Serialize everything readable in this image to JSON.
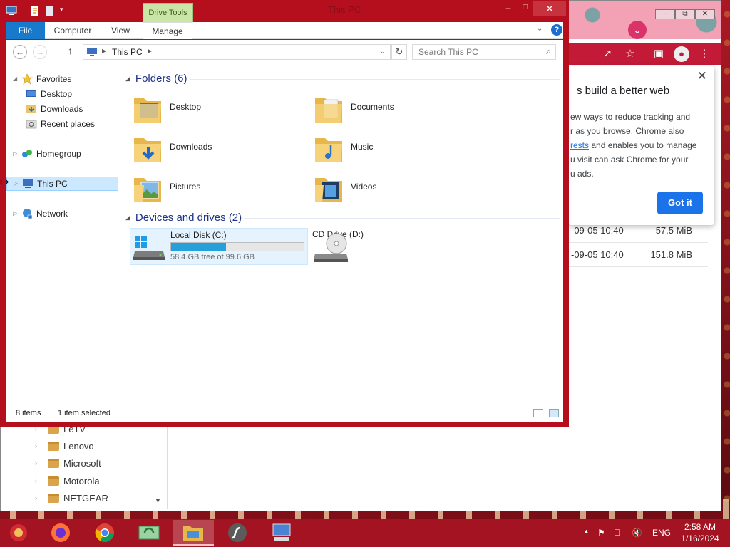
{
  "explorer": {
    "title": "This PC",
    "context_tab": "Drive Tools",
    "tabs": [
      "File",
      "Computer",
      "View",
      "Manage"
    ],
    "address": {
      "segment": "This PC"
    },
    "search_placeholder": "Search This PC",
    "nav": {
      "favorites": "Favorites",
      "desktop": "Desktop",
      "downloads": "Downloads",
      "recent": "Recent places",
      "homegroup": "Homegroup",
      "thispc": "This PC",
      "network": "Network"
    },
    "folders_header": "Folders (6)",
    "folders": [
      "Desktop",
      "Documents",
      "Downloads",
      "Music",
      "Pictures",
      "Videos"
    ],
    "devices_header": "Devices and drives (2)",
    "drives": {
      "local_name": "Local Disk (C:)",
      "local_free": "58.4 GB free of 99.6 GB",
      "local_used_fraction": 0.414,
      "cd_name": "CD Drive (D:)"
    },
    "status": {
      "items": "8 items",
      "selected": "1 item selected"
    }
  },
  "chrome": {
    "popup": {
      "title": "s build a better web",
      "line1": "ew ways to reduce tracking and",
      "line2": "r as you browse. Chrome also",
      "line3_link": "rests",
      "line3_rest": " and enables you to manage",
      "line4": "u visit can ask Chrome for your",
      "line5": "u ads.",
      "button": "Got it"
    },
    "downloads": [
      {
        "date": "-09-05 10:40",
        "size": "57.5 MiB"
      },
      {
        "date": "-09-05 10:40",
        "size": "151.8 MiB"
      }
    ],
    "folders": [
      "LeTV",
      "Lenovo",
      "Microsoft",
      "Motorola",
      "NETGEAR"
    ]
  },
  "taskbar": {
    "apps": [
      "firefox-icon",
      "chrome-icon",
      "sync-icon",
      "file-explorer-icon",
      "flash-icon",
      "remote-desktop-icon"
    ],
    "language": "ENG",
    "time": "2:58 AM",
    "date": "1/16/2024"
  },
  "colors": {
    "accent": "#1979ca",
    "window_border": "#b50f1e",
    "selection": "#cce8ff",
    "progress": "#26a0da"
  }
}
